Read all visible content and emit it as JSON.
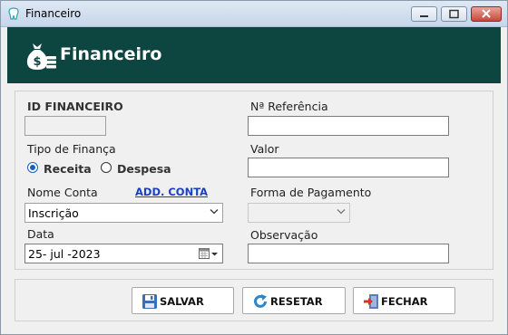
{
  "window": {
    "title": "Financeiro"
  },
  "header": {
    "title": "Financeiro"
  },
  "form": {
    "id_label": "ID FINANCEIRO",
    "id_value": "",
    "ref_label": "Nª Referência",
    "ref_value": "",
    "tipo_label": "Tipo de Finança",
    "tipo_options": [
      "Receita",
      "Despesa"
    ],
    "tipo_selected": "Receita",
    "valor_label": "Valor",
    "valor_value": "",
    "conta_label": "Nome Conta",
    "add_conta_link": "ADD. CONTA",
    "conta_value": "Inscrição",
    "pagamento_label": "Forma de Pagamento",
    "pagamento_value": "",
    "data_label": "Data",
    "data_value": "25- jul -2023",
    "obs_label": "Observação",
    "obs_value": ""
  },
  "buttons": {
    "save": "SALVAR",
    "reset": "RESETAR",
    "close": "FECHAR"
  },
  "colors": {
    "header_bg": "#0d4540",
    "link": "#1a3fc2",
    "radio_accent": "#1a5fb4"
  }
}
